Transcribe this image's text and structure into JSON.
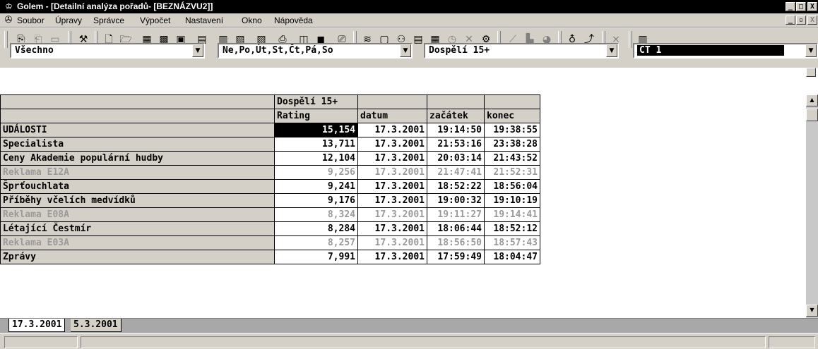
{
  "window": {
    "title": "Golem - [Detailní analýza pořadů- [BEZNÁZVU2]]",
    "controls": [
      "_",
      "□",
      "X"
    ],
    "child_controls": [
      "_",
      "▫",
      "X"
    ]
  },
  "menu": [
    "Soubor",
    "Úpravy",
    "Správce",
    "Výpočet",
    "Nastavení",
    "Okno",
    "Nápověda"
  ],
  "filters": {
    "programs": "Všechno",
    "days": "Ne,Po,Út,St,Čt,Pá,So",
    "target": "Dospělí 15+",
    "channel": "ČT 1"
  },
  "table": {
    "group_header": "Dospělí 15+",
    "columns": [
      "Rating",
      "datum",
      "začátek",
      "konec"
    ],
    "rows": [
      {
        "name": "UDÁLOSTI",
        "rating": "15,154",
        "date": "17.3.2001",
        "start": "19:14:50",
        "end": "19:38:55",
        "gray": false
      },
      {
        "name": "Specialista",
        "rating": "13,711",
        "date": "17.3.2001",
        "start": "21:53:16",
        "end": "23:38:28",
        "gray": false
      },
      {
        "name": "Ceny Akademie populární hudby",
        "rating": "12,104",
        "date": "17.3.2001",
        "start": "20:03:14",
        "end": "21:43:52",
        "gray": false
      },
      {
        "name": "Reklama  E12A",
        "rating": "9,256",
        "date": "17.3.2001",
        "start": "21:47:41",
        "end": "21:52:31",
        "gray": true
      },
      {
        "name": "Šprťouchlata",
        "rating": "9,241",
        "date": "17.3.2001",
        "start": "18:52:22",
        "end": "18:56:04",
        "gray": false
      },
      {
        "name": "Příběhy včelích medvídků",
        "rating": "9,176",
        "date": "17.3.2001",
        "start": "19:00:32",
        "end": "19:10:19",
        "gray": false
      },
      {
        "name": "Reklama  E08A",
        "rating": "8,324",
        "date": "17.3.2001",
        "start": "19:11:27",
        "end": "19:14:41",
        "gray": true
      },
      {
        "name": "Létající Čestmír",
        "rating": "8,284",
        "date": "17.3.2001",
        "start": "18:06:44",
        "end": "18:52:12",
        "gray": false
      },
      {
        "name": "Reklama  E03A",
        "rating": "8,257",
        "date": "17.3.2001",
        "start": "18:56:50",
        "end": "18:57:43",
        "gray": true
      },
      {
        "name": "Zprávy",
        "rating": "7,991",
        "date": "17.3.2001",
        "start": "17:59:49",
        "end": "18:04:47",
        "gray": false
      }
    ]
  },
  "tabs": [
    "17.3.2001",
    "5.3.2001"
  ]
}
